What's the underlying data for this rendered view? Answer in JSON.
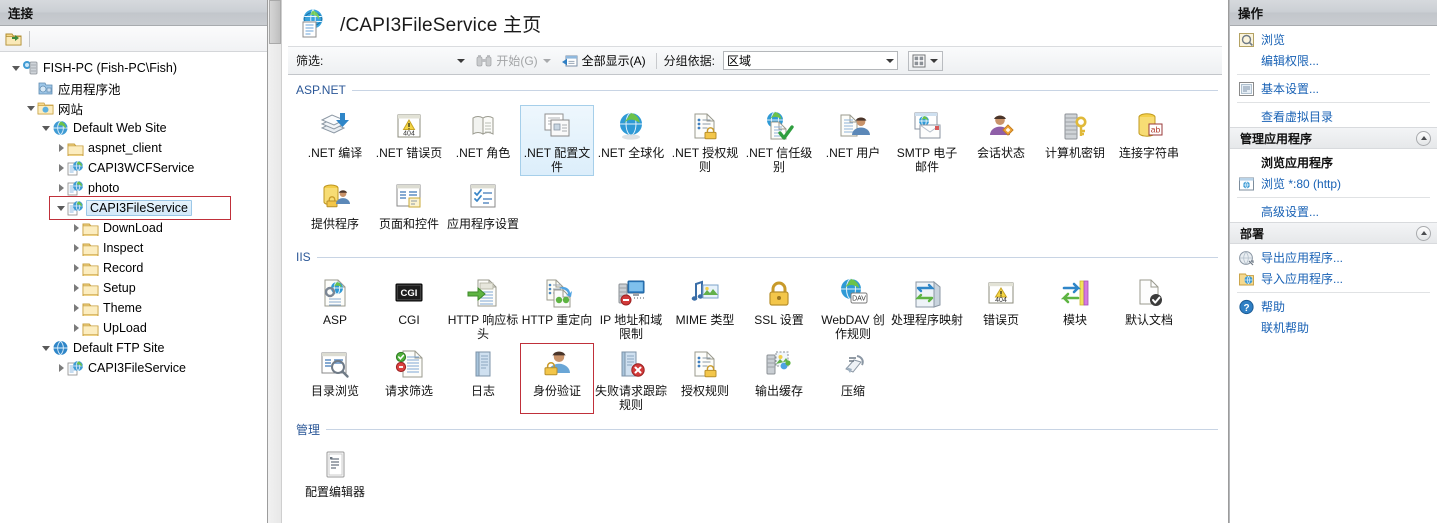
{
  "left_pane": {
    "header": "连接",
    "toolbar_icons": [
      "connect-to-server-icon"
    ],
    "tree": [
      {
        "label": "FISH-PC (Fish-PC\\Fish)",
        "level": 0,
        "expander": "open",
        "icon": "server-icon"
      },
      {
        "label": "应用程序池",
        "level": 1,
        "expander": "none",
        "icon": "app-pools-icon"
      },
      {
        "label": "网站",
        "level": 1,
        "expander": "open",
        "icon": "sites-folder-icon"
      },
      {
        "label": "Default Web Site",
        "level": 2,
        "expander": "open",
        "icon": "website-icon"
      },
      {
        "label": "aspnet_client",
        "level": 3,
        "expander": "closed",
        "icon": "folder-icon"
      },
      {
        "label": "CAPI3WCFService",
        "level": 3,
        "expander": "closed",
        "icon": "application-icon"
      },
      {
        "label": "photo",
        "level": 3,
        "expander": "closed",
        "icon": "application-icon"
      },
      {
        "label": "CAPI3FileService",
        "level": 3,
        "expander": "open",
        "icon": "application-icon",
        "selected": true,
        "highlighted": true
      },
      {
        "label": "DownLoad",
        "level": 4,
        "expander": "closed",
        "icon": "folder-icon"
      },
      {
        "label": "Inspect",
        "level": 4,
        "expander": "closed",
        "icon": "folder-icon"
      },
      {
        "label": "Record",
        "level": 4,
        "expander": "closed",
        "icon": "folder-icon"
      },
      {
        "label": "Setup",
        "level": 4,
        "expander": "closed",
        "icon": "folder-icon"
      },
      {
        "label": "Theme",
        "level": 4,
        "expander": "closed",
        "icon": "folder-icon"
      },
      {
        "label": "UpLoad",
        "level": 4,
        "expander": "closed",
        "icon": "folder-icon"
      },
      {
        "label": "Default FTP Site",
        "level": 2,
        "expander": "open",
        "icon": "ftp-site-icon"
      },
      {
        "label": "CAPI3FileService",
        "level": 3,
        "expander": "closed",
        "icon": "application-icon"
      }
    ]
  },
  "center": {
    "title": "/CAPI3FileService 主页",
    "title_icon": "application-page-icon",
    "filter_bar": {
      "filter_label": "筛选:",
      "filter_value": "",
      "filter_placeholder": "",
      "go_label": "开始(G)",
      "go_icon": "binoculars-icon",
      "show_all_label": "全部显示(A)",
      "show_all_icon": "show-all-icon",
      "group_by_label": "分组依据:",
      "group_by_value": "区域",
      "view_icon": "view-mode-icon"
    },
    "groups": [
      {
        "name": "ASP.NET",
        "items": [
          {
            "label": ".NET 编译",
            "icon": "net-compilation-icon"
          },
          {
            "label": ".NET 错误页",
            "icon": "net-error-pages-icon"
          },
          {
            "label": ".NET 角色",
            "icon": "net-roles-icon"
          },
          {
            "label": ".NET 配置文件",
            "icon": "net-profile-icon",
            "selected": true
          },
          {
            "label": ".NET 全球化",
            "icon": "net-globalization-icon"
          },
          {
            "label": ".NET 授权规则",
            "icon": "net-authorization-rules-icon"
          },
          {
            "label": ".NET 信任级别",
            "icon": "net-trust-levels-icon"
          },
          {
            "label": ".NET 用户",
            "icon": "net-users-icon"
          },
          {
            "label": "SMTP 电子邮件",
            "icon": "smtp-email-icon"
          },
          {
            "label": "会话状态",
            "icon": "session-state-icon"
          },
          {
            "label": "计算机密钥",
            "icon": "machine-key-icon"
          },
          {
            "label": "连接字符串",
            "icon": "connection-strings-icon"
          },
          {
            "label": "提供程序",
            "icon": "providers-icon"
          },
          {
            "label": "页面和控件",
            "icon": "pages-and-controls-icon"
          },
          {
            "label": "应用程序设置",
            "icon": "application-settings-icon"
          }
        ]
      },
      {
        "name": "IIS",
        "items": [
          {
            "label": "ASP",
            "icon": "asp-icon"
          },
          {
            "label": "CGI",
            "icon": "cgi-icon"
          },
          {
            "label": "HTTP 响应标头",
            "icon": "http-response-headers-icon"
          },
          {
            "label": "HTTP 重定向",
            "icon": "http-redirect-icon"
          },
          {
            "label": "IP 地址和域限制",
            "icon": "ip-address-domain-restrictions-icon"
          },
          {
            "label": "MIME 类型",
            "icon": "mime-types-icon"
          },
          {
            "label": "SSL 设置",
            "icon": "ssl-settings-icon"
          },
          {
            "label": "WebDAV 创作规则",
            "icon": "webdav-authoring-rules-icon"
          },
          {
            "label": "处理程序映射",
            "icon": "handler-mappings-icon"
          },
          {
            "label": "错误页",
            "icon": "error-pages-icon"
          },
          {
            "label": "模块",
            "icon": "modules-icon"
          },
          {
            "label": "默认文档",
            "icon": "default-document-icon"
          },
          {
            "label": "目录浏览",
            "icon": "directory-browsing-icon"
          },
          {
            "label": "请求筛选",
            "icon": "request-filtering-icon"
          },
          {
            "label": "日志",
            "icon": "logging-icon"
          },
          {
            "label": "身份验证",
            "icon": "authentication-icon",
            "redmark": true
          },
          {
            "label": "失败请求跟踪规则",
            "icon": "failed-request-tracing-rules-icon"
          },
          {
            "label": "授权规则",
            "icon": "authorization-rules-icon"
          },
          {
            "label": "输出缓存",
            "icon": "output-caching-icon"
          },
          {
            "label": "压缩",
            "icon": "compression-icon"
          }
        ]
      },
      {
        "name": "管理",
        "items": [
          {
            "label": "配置编辑器",
            "icon": "configuration-editor-icon"
          }
        ]
      }
    ]
  },
  "right_pane": {
    "header": "操作",
    "sections": [
      {
        "title": null,
        "items": [
          {
            "label": "浏览",
            "icon": "browse-icon",
            "type": "link"
          },
          {
            "label": "编辑权限...",
            "icon": null,
            "type": "link"
          },
          {
            "divider": true
          },
          {
            "label": "基本设置...",
            "icon": "basic-settings-icon",
            "type": "link"
          },
          {
            "divider": true
          },
          {
            "label": "查看虚拟目录",
            "icon": null,
            "type": "link"
          }
        ]
      },
      {
        "title": "管理应用程序",
        "collapse_icon": "chevron-up-icon",
        "items": [
          {
            "label": "浏览应用程序",
            "icon": null,
            "type": "heading"
          },
          {
            "label": "浏览 *:80 (http)",
            "icon": "browse-site-icon",
            "type": "link"
          },
          {
            "divider": true
          },
          {
            "label": "高级设置...",
            "icon": null,
            "type": "link"
          }
        ]
      },
      {
        "title": "部署",
        "collapse_icon": "chevron-up-icon",
        "items": [
          {
            "label": "导出应用程序...",
            "icon": "export-application-icon",
            "type": "link"
          },
          {
            "label": "导入应用程序...",
            "icon": "import-application-icon",
            "type": "link"
          },
          {
            "divider": true
          },
          {
            "label": "帮助",
            "icon": "help-icon",
            "type": "link"
          },
          {
            "label": "联机帮助",
            "icon": null,
            "type": "link"
          }
        ]
      }
    ]
  },
  "colors": {
    "accent_link": "#1962b5",
    "group_header": "#2b5797",
    "selection_fill": "#dceefb",
    "selection_border": "#a6cfea",
    "annotation_red": "#c0303a",
    "pane_header_bg": "#c9ccd1"
  }
}
